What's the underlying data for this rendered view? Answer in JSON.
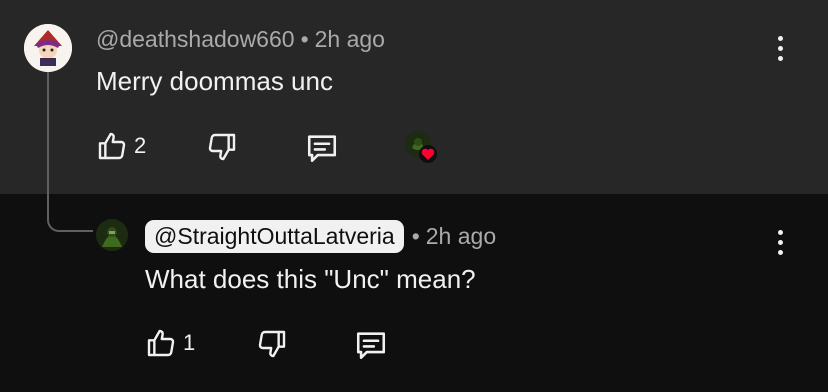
{
  "comment": {
    "author": "@deathshadow660",
    "separator": "•",
    "time": "2h ago",
    "text": "Merry doommas unc",
    "like_count": "2",
    "icons": {
      "like": "thumbs-up-icon",
      "dislike": "thumbs-down-icon",
      "reply": "comment-reply-icon",
      "more": "more-vert-icon",
      "heart": "heart-icon"
    }
  },
  "reply": {
    "author": "@StraightOuttaLatveria",
    "separator": "•",
    "time": "2h ago",
    "text": "What does this \"Unc\" mean?",
    "like_count": "1"
  },
  "colors": {
    "top_background": "#272727",
    "page_background": "#0f0f0f",
    "text_primary": "#f1f1f1",
    "text_secondary": "#aaaaaa",
    "heart": "#ff0033"
  }
}
